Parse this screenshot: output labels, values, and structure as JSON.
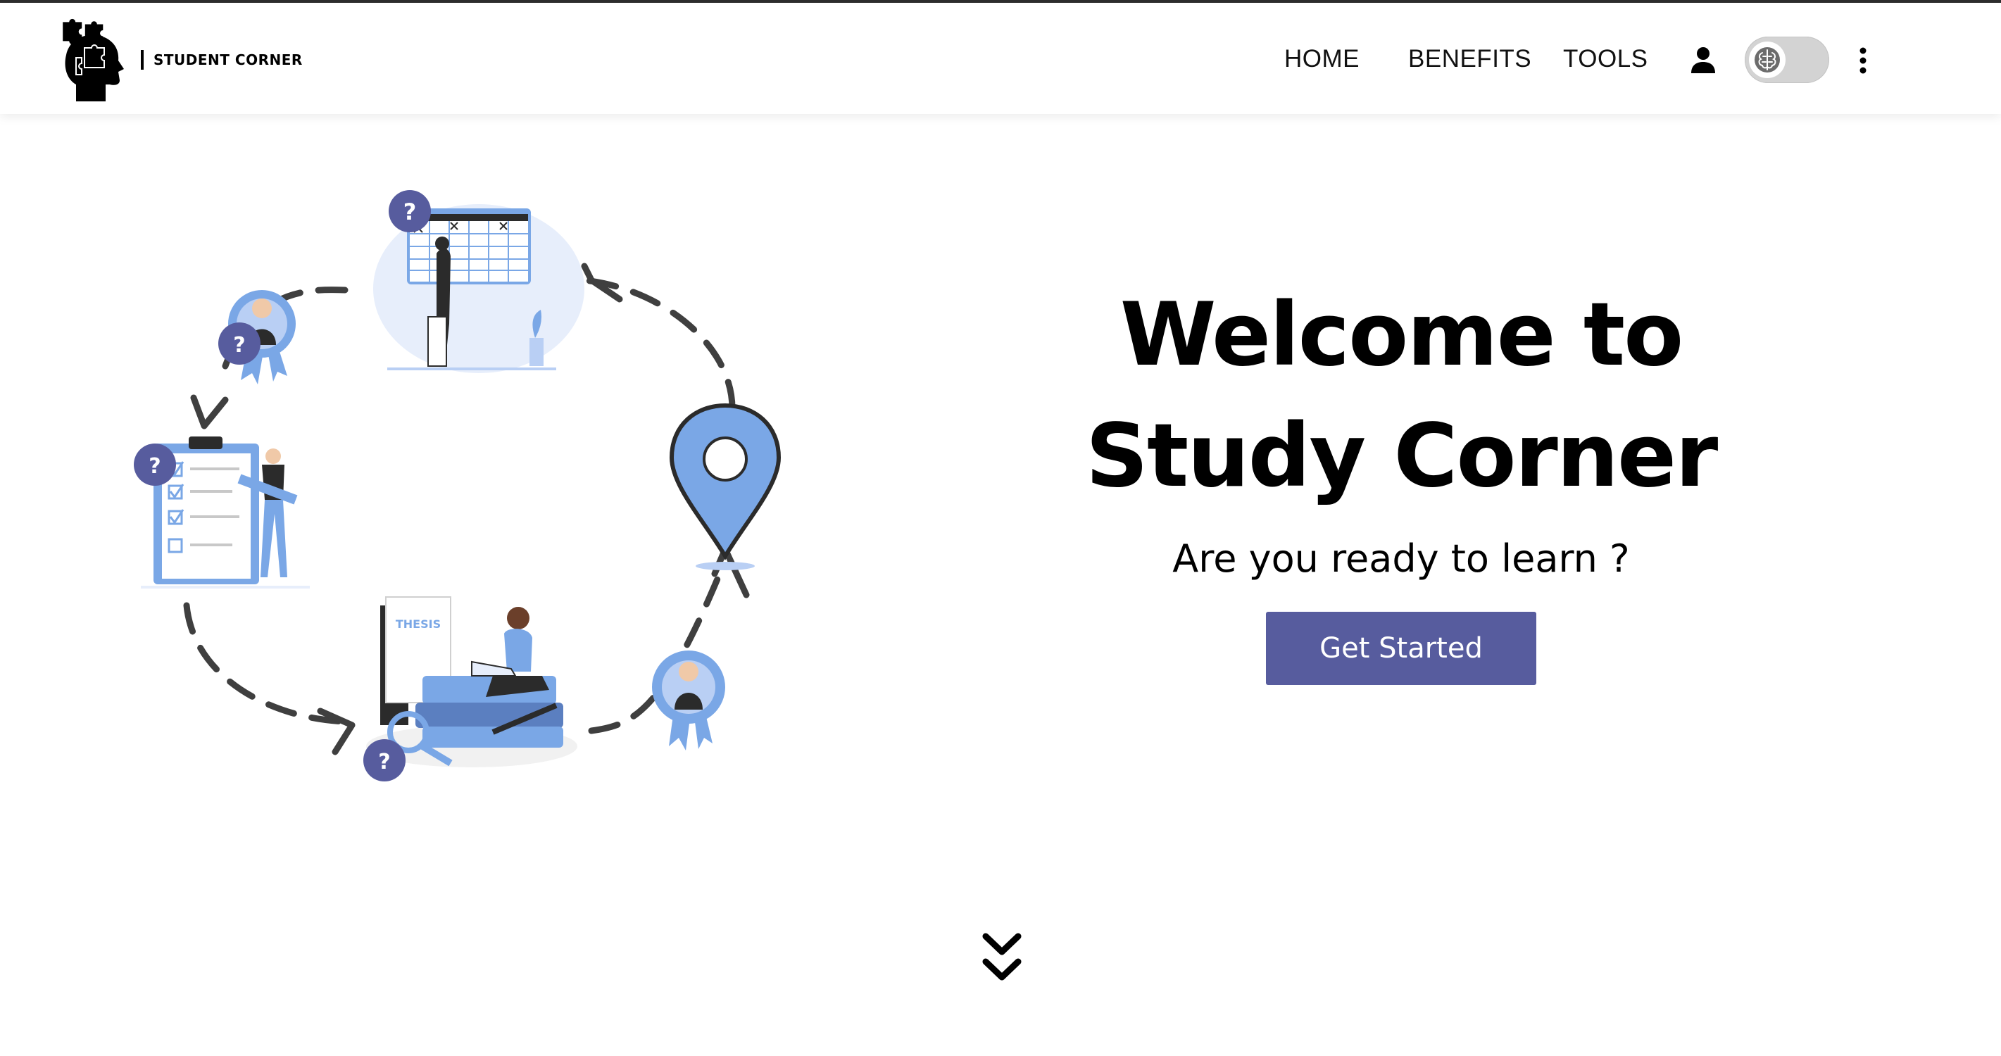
{
  "brand": {
    "name": "STUDENT CORNER",
    "logo_icon": "puzzle-head-icon"
  },
  "nav": {
    "links": [
      "HOME",
      "BENEFITS",
      "TOOLS"
    ],
    "user_icon": "user-icon",
    "toggle_icon": "brain-icon",
    "menu_icon": "more-vertical-icon"
  },
  "hero": {
    "title_line1": "Welcome to",
    "title_line2": "Study Corner",
    "subtitle": "Are you ready to learn ?",
    "cta": "Get Started"
  },
  "illustration": {
    "badge_label": "?",
    "book_label": "THESIS"
  },
  "scroll_icon": "double-chevron-down-icon",
  "colors": {
    "accent": "#575c9e",
    "illustration_blue": "#7aa7e6",
    "badge": "#575c9e"
  }
}
